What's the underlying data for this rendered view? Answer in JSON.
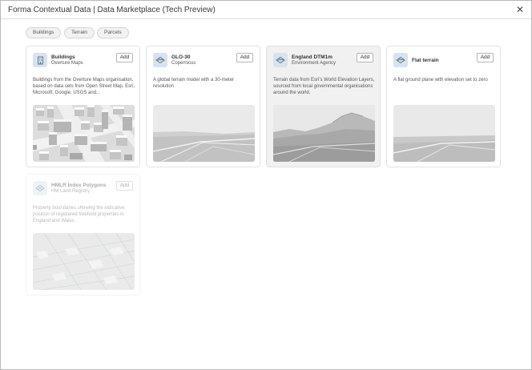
{
  "window": {
    "title": "Forma Contextual Data | Data Marketplace (Tech Preview)",
    "close_glyph": "✕"
  },
  "filters": [
    {
      "label": "Buildings"
    },
    {
      "label": "Terrain"
    },
    {
      "label": "Parcels"
    }
  ],
  "cards": [
    {
      "title": "Buildings",
      "provider": "Overture Maps",
      "add_label": "Add",
      "description": "Buildings from the Overture Maps organisation, based on data sets from Open Street Map, Esri, Microsoft, Google, USGS and...",
      "icon": "building-icon"
    },
    {
      "title": "GLO-30",
      "provider": "Copernicus",
      "add_label": "Add",
      "description": "A global terrain model with a 30-meter resolution",
      "icon": "terrain-icon"
    },
    {
      "title": "England DTM1m",
      "provider": "Environment Agency",
      "add_label": "Add",
      "description": "Terrain data from Esri's World Elevation Layers, sourced from local governmental organisations around the world.",
      "icon": "terrain-icon"
    },
    {
      "title": "Flat terrain",
      "provider": "",
      "add_label": "Add",
      "description": "A flat ground plane with elevation set to zero",
      "icon": "terrain-icon"
    },
    {
      "title": "HMLR Index Polygons",
      "provider": "HM Land Registry",
      "add_label": "Add",
      "description": "Property boundaries showing the indicative position of registered freehold properties in England and Wales.",
      "icon": "parcel-icon"
    }
  ],
  "colors": {
    "icon_bg": "#d8e3ec",
    "icon_fg": "#5b7a93"
  }
}
